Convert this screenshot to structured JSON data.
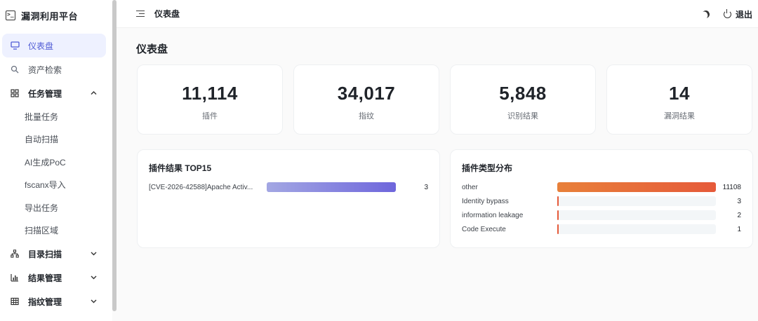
{
  "app": {
    "title": "漏洞利用平台",
    "brand_icon_glyph": ">_"
  },
  "sidebar": {
    "items": [
      {
        "label": "仪表盘",
        "icon": "monitor-icon"
      },
      {
        "label": "资产检索",
        "icon": "search-icon"
      }
    ],
    "task_group": {
      "label": "任务管理",
      "icon": "grid-icon",
      "expanded": true,
      "children": [
        "批量任务",
        "自动扫描",
        "AI生成PoC",
        "fscanx导入",
        "导出任务",
        "扫描区域"
      ]
    },
    "groups": [
      {
        "label": "目录扫描",
        "icon": "sitemap-icon"
      },
      {
        "label": "结果管理",
        "icon": "bar-chart-icon"
      },
      {
        "label": "指纹管理",
        "icon": "table-icon"
      }
    ]
  },
  "header": {
    "title": "仪表盘",
    "logout_label": "退出"
  },
  "page": {
    "title": "仪表盘"
  },
  "stats": [
    {
      "value": "11,114",
      "label": "插件"
    },
    {
      "value": "34,017",
      "label": "指纹"
    },
    {
      "value": "5,848",
      "label": "识别结果"
    },
    {
      "value": "14",
      "label": "漏洞结果"
    }
  ],
  "colors": {
    "accent": "#4f5bd5",
    "purple_bar": "#7b78e0",
    "orange_bar": "#e65a3a",
    "track": "#f3f6f8"
  },
  "plugin_top": {
    "title": "插件结果 TOP15",
    "rows": [
      {
        "label": "[CVE-2026-42588]Apache Activ...",
        "value": 3
      }
    ]
  },
  "plugin_types": {
    "title": "插件类型分布",
    "rows": [
      {
        "label": "other",
        "value": 11108
      },
      {
        "label": "Identity bypass",
        "value": 3
      },
      {
        "label": "information leakage",
        "value": 2
      },
      {
        "label": "Code Execute",
        "value": 1
      }
    ]
  }
}
